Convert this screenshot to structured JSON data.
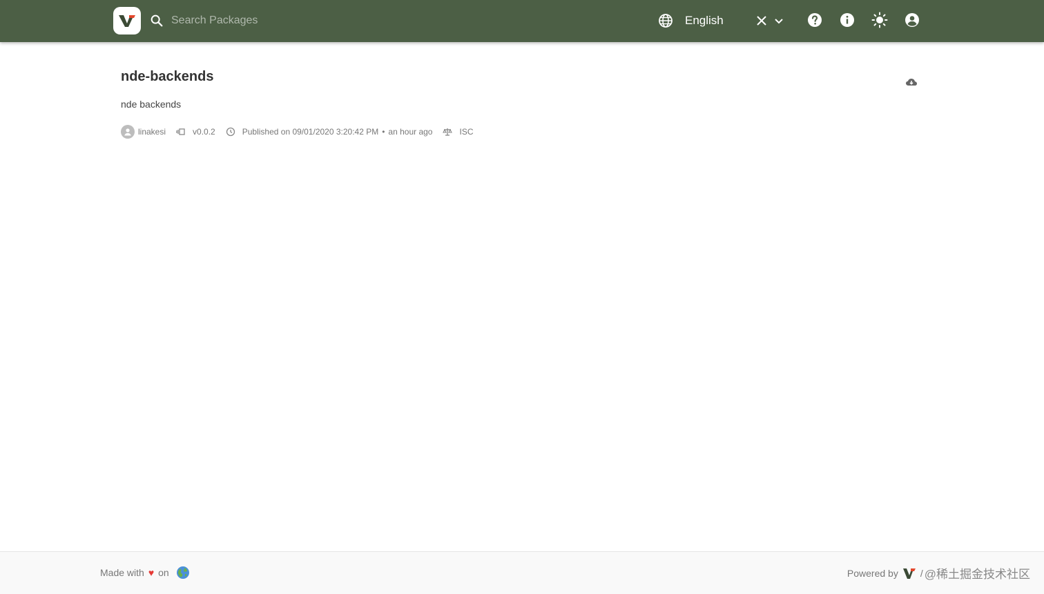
{
  "header": {
    "search_placeholder": "Search Packages",
    "language": "English",
    "icons": [
      "search-icon",
      "globe-icon",
      "close-icon",
      "chevron-down-icon",
      "help-icon",
      "info-icon",
      "theme-sun-icon",
      "account-icon"
    ]
  },
  "package": {
    "name": "nde-backends",
    "description": "nde backends",
    "author": "linakesi",
    "version": "v0.0.2",
    "published": "Published on 09/01/2020 3:20:42 PM",
    "dot": "•",
    "relative_time": "an hour ago",
    "license": "ISC"
  },
  "footer": {
    "made_with": "Made with",
    "heart": "♥",
    "on": "on",
    "powered_by": "Powered by",
    "slash": "/",
    "watermark": "@稀土掘金技术社区"
  },
  "colors": {
    "topbar": "#4c5f45",
    "heart": "#e53935"
  }
}
